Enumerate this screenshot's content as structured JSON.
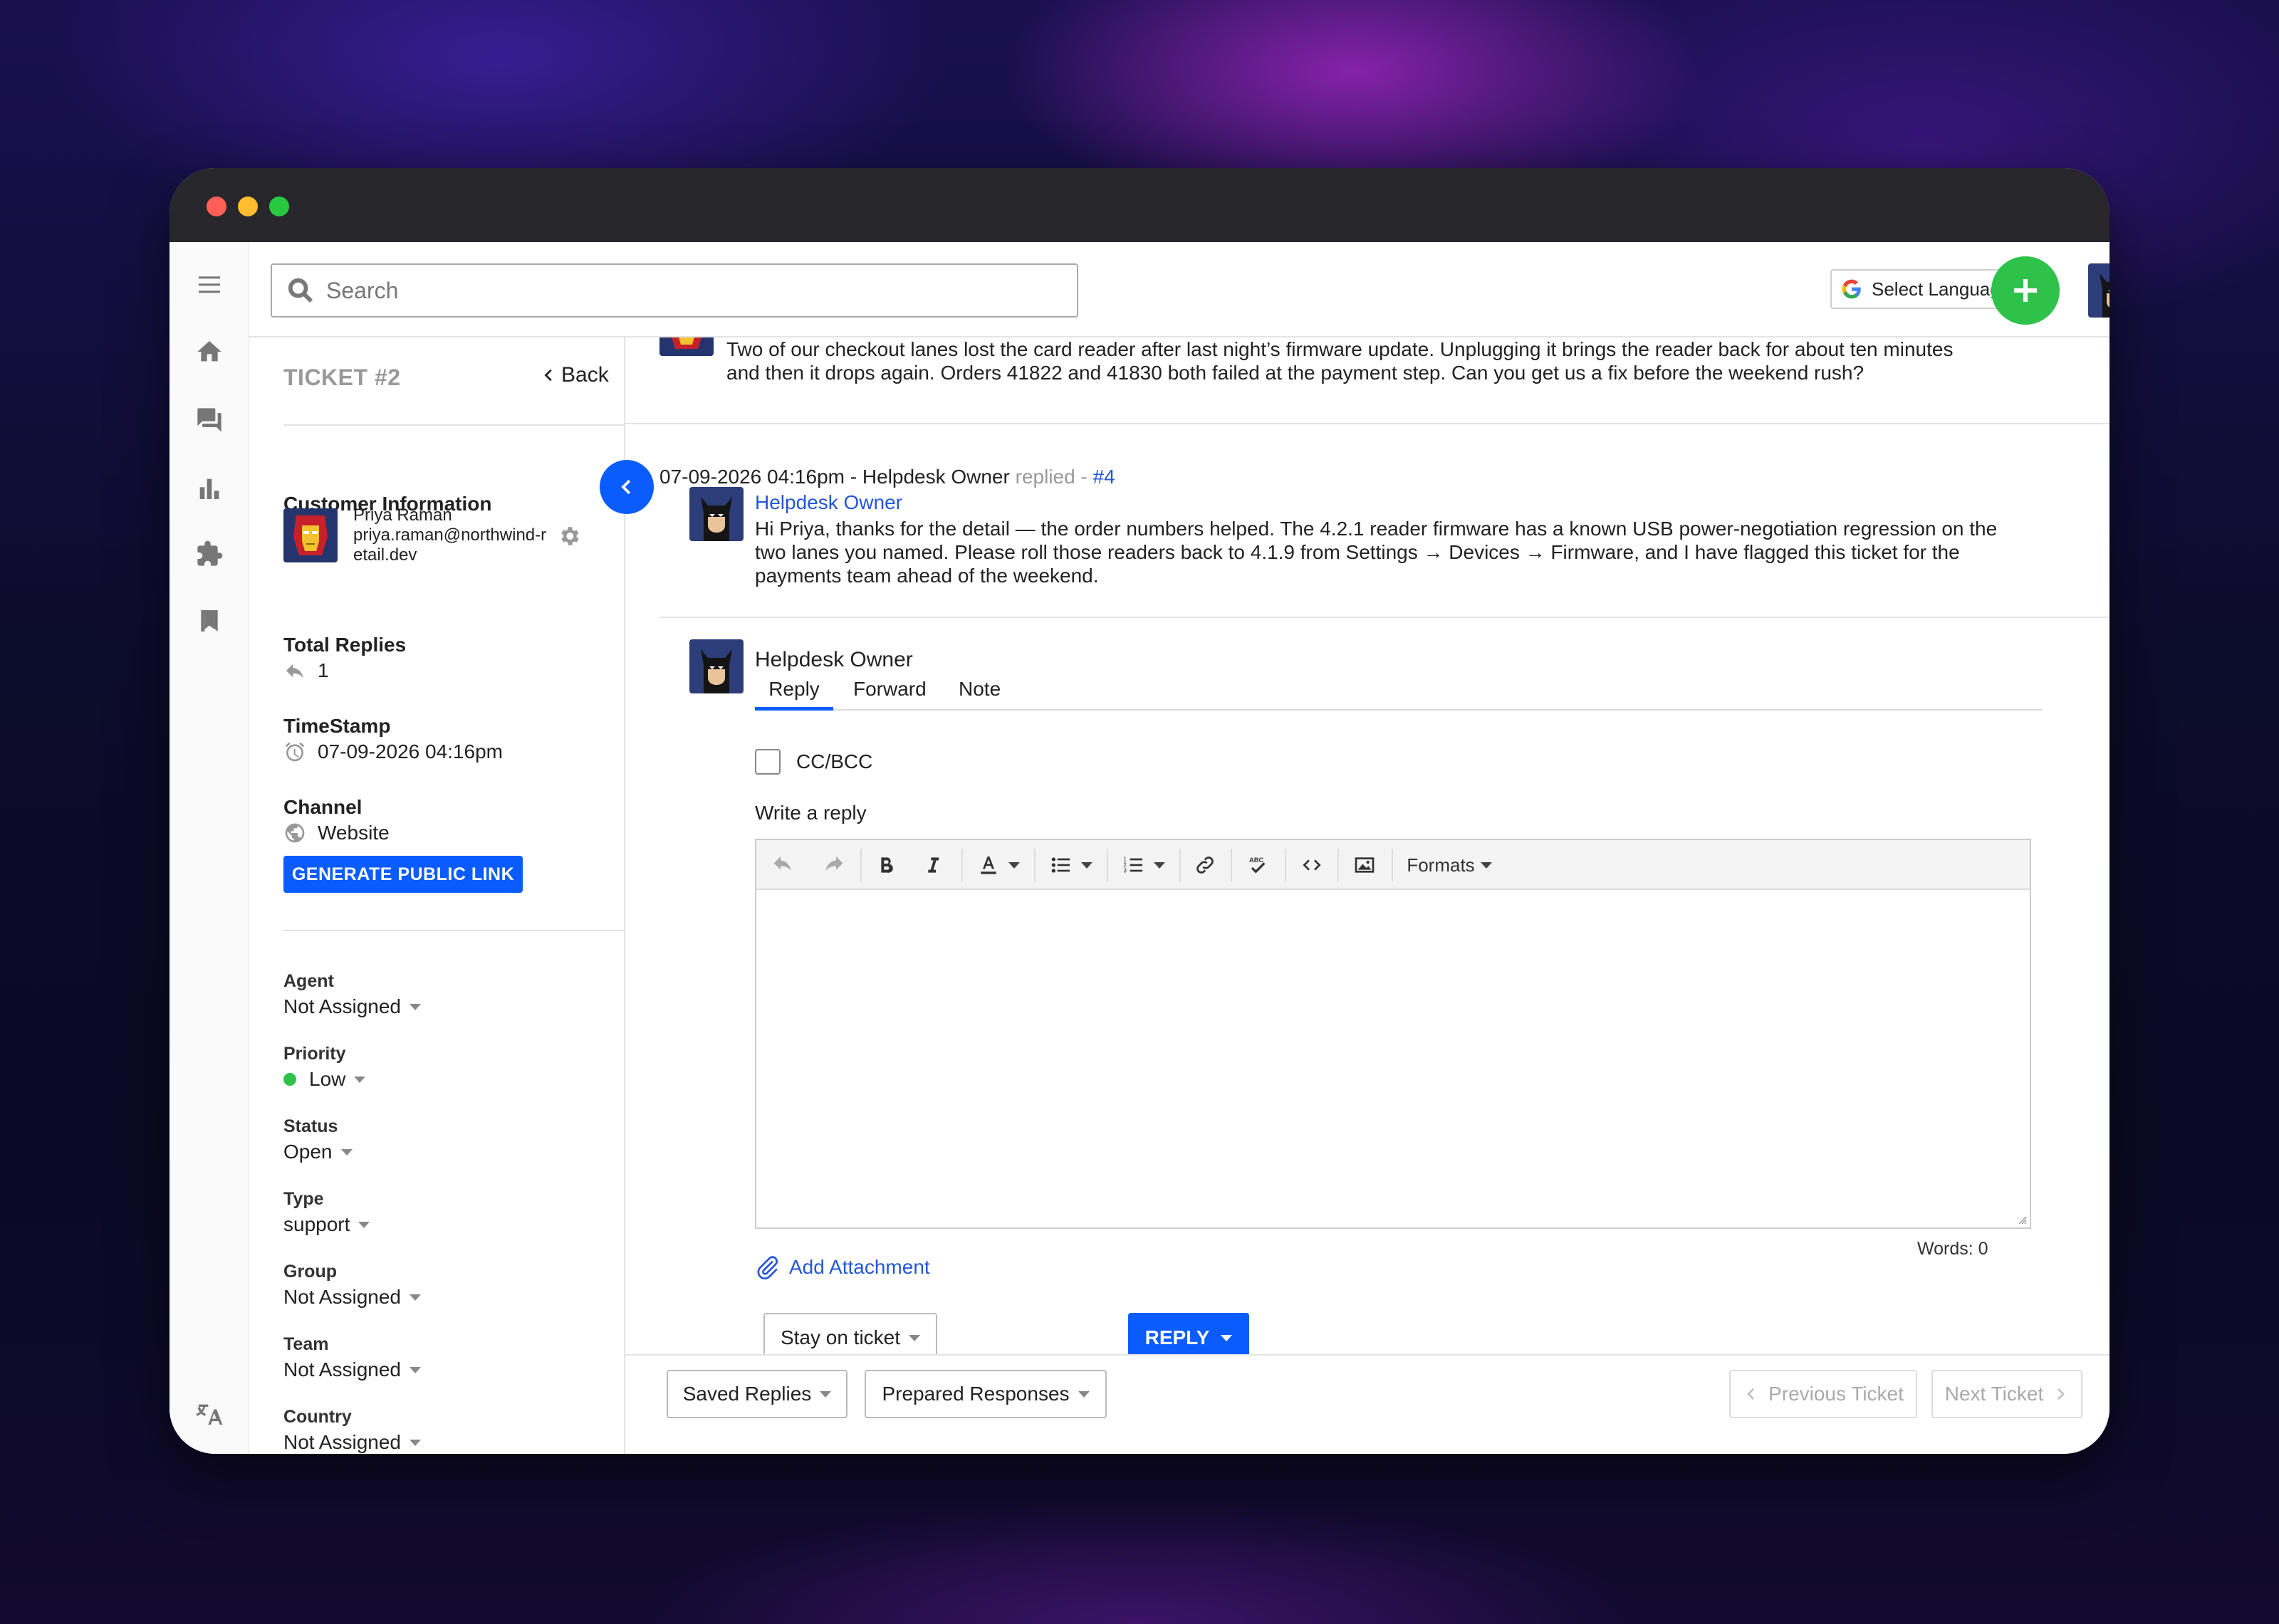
{
  "colors": {
    "accent": "#0b5cff",
    "add_button": "#2ec24a",
    "link": "#2457d6",
    "priority_low": "#2ec24a"
  },
  "header": {
    "search_placeholder": "Search",
    "language_label": "Select Language"
  },
  "rail": {
    "icons": [
      "menu-icon",
      "home-icon",
      "forum-icon",
      "chart-icon",
      "puzzle-icon",
      "bookmark-icon",
      "translate-icon"
    ]
  },
  "ticket": {
    "title": "TICKET #2",
    "back_label": "Back"
  },
  "customer": {
    "section_label": "Customer Information",
    "name": "Priya Raman",
    "email_line1": "priya.raman@northwind-r",
    "email_line2": "etail.dev"
  },
  "total_replies": {
    "label": "Total Replies",
    "value": "1"
  },
  "timestamp": {
    "label": "TimeStamp",
    "value": "07-09-2026 04:16pm"
  },
  "channel": {
    "label": "Channel",
    "value": "Website"
  },
  "generate_link_label": "GENERATE PUBLIC LINK",
  "properties": [
    {
      "label": "Agent",
      "value": "Not Assigned"
    },
    {
      "label": "Priority",
      "value": "Low"
    },
    {
      "label": "Status",
      "value": "Open"
    },
    {
      "label": "Type",
      "value": "support"
    },
    {
      "label": "Group",
      "value": "Not Assigned"
    },
    {
      "label": "Team",
      "value": "Not Assigned"
    },
    {
      "label": "Country",
      "value": "Not Assigned"
    }
  ],
  "thread": {
    "first_message_line1": "Two of our checkout lanes lost the card reader after last night’s firmware update. Unplugging it brings the reader back for about ten minutes",
    "first_message_line2": "and then it drops again. Orders 41822 and 41830 both failed at the payment step. Can you get us a fix before the weekend rush?",
    "reply_meta": "07-09-2026 04:16pm - Helpdesk Owner",
    "reply_replied": "replied -",
    "reply_number": "#4",
    "reply_author": "Helpdesk Owner",
    "reply_line1": "Hi Priya, thanks for the detail — the order numbers helped. The 4.2.1 reader firmware has a known USB power-negotiation regression on the",
    "reply_line2": "two lanes you named. Please roll those readers back to 4.1.9 from Settings → Devices → Firmware, and I have flagged this ticket for the",
    "reply_line3": "payments team ahead of the weekend."
  },
  "composer": {
    "author": "Helpdesk Owner",
    "tabs": [
      "Reply",
      "Forward",
      "Note"
    ],
    "active_tab": "Reply",
    "cc_label": "CC/BCC",
    "write_label": "Write a reply",
    "formats_label": "Formats",
    "words_label": "Words: 0",
    "attachment_label": "Add Attachment",
    "stay_label": "Stay on ticket",
    "reply_button": "REPLY"
  },
  "footer": {
    "saved_replies": "Saved Replies",
    "prepared_responses": "Prepared Responses",
    "previous_ticket": "Previous Ticket",
    "next_ticket": "Next Ticket"
  }
}
